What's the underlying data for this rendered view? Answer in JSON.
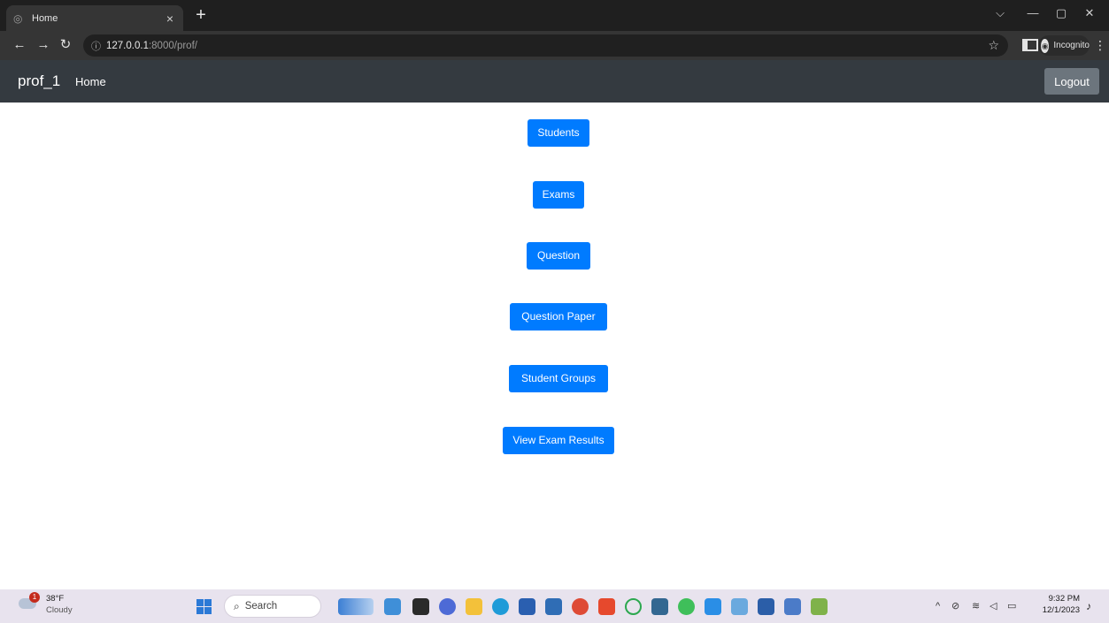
{
  "browser": {
    "tab_title": "Home",
    "tab_close": "×",
    "new_tab": "+",
    "url_host": "127.0.0.1",
    "url_path": ":8000/prof/",
    "profile_label": "Incognito",
    "window_controls": {
      "minimize": "—",
      "restore": "▢",
      "close": "✕",
      "tab_search": "⌵"
    }
  },
  "navbar": {
    "brand": "prof_1",
    "home_link": "Home",
    "logout_label": "Logout"
  },
  "menu": {
    "students": "Students",
    "exams": "Exams",
    "question": "Question",
    "question_paper": "Question Paper",
    "student_groups": "Student Groups",
    "view_exam_results": "View Exam Results"
  },
  "taskbar": {
    "weather_temp": "38°F",
    "weather_condition": "Cloudy",
    "weather_badge": "1",
    "search_placeholder": "Search",
    "time": "9:32 PM",
    "date": "12/1/2023"
  },
  "colors": {
    "primary_button": "#007bff",
    "navbar_bg": "#343a40",
    "logout_bg": "#6c757d",
    "chrome_tabstrip": "#1f1f1f",
    "chrome_toolbar": "#353535",
    "taskbar_bg": "#e8e3ee"
  }
}
